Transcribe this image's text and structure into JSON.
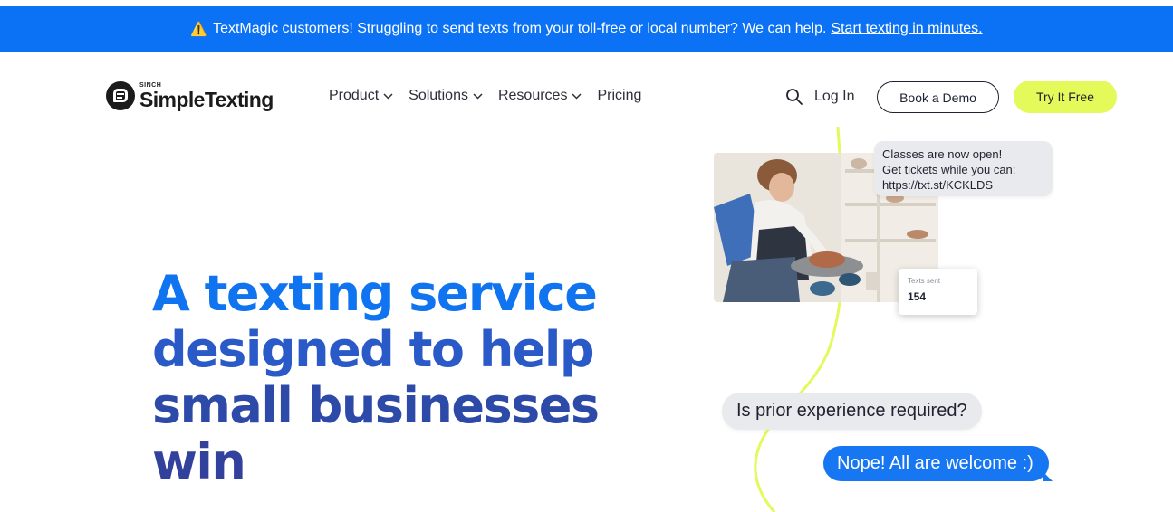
{
  "announcement": {
    "icon": "warning-icon",
    "text": "TextMagic customers! Struggling to send texts from your toll-free or local number? We can help.",
    "link_text": "Start texting in minutes.",
    "background": "#0b72f5"
  },
  "header": {
    "logo": {
      "brand_small": "SINCH",
      "brand_name": "SimpleTexting"
    },
    "nav": [
      {
        "label": "Product",
        "has_dropdown": true
      },
      {
        "label": "Solutions",
        "has_dropdown": true
      },
      {
        "label": "Resources",
        "has_dropdown": true
      },
      {
        "label": "Pricing",
        "has_dropdown": false
      }
    ],
    "search_icon": "search-icon",
    "login_label": "Log In",
    "demo_label": "Book a Demo",
    "try_label": "Try It Free",
    "try_color": "#e4f95a"
  },
  "hero": {
    "title_lines": [
      "A texting service",
      "designed to help",
      "small businesses",
      "win"
    ],
    "title_colors": [
      "#1073f0",
      "#2a59c8",
      "#2e4aa8",
      "#32419c"
    ]
  },
  "illustration": {
    "incoming_message_lines": [
      "Classes are now open!",
      "Get tickets while you can:",
      "https://txt.st/KCKLDS"
    ],
    "stat_card": {
      "label": "Texts sent",
      "value": "154"
    },
    "question_bubble": "Is prior experience required?",
    "answer_bubble": "Nope! All are welcome :)",
    "accent_curve_color": "#e4f95a",
    "answer_bubble_color": "#1776f2"
  }
}
